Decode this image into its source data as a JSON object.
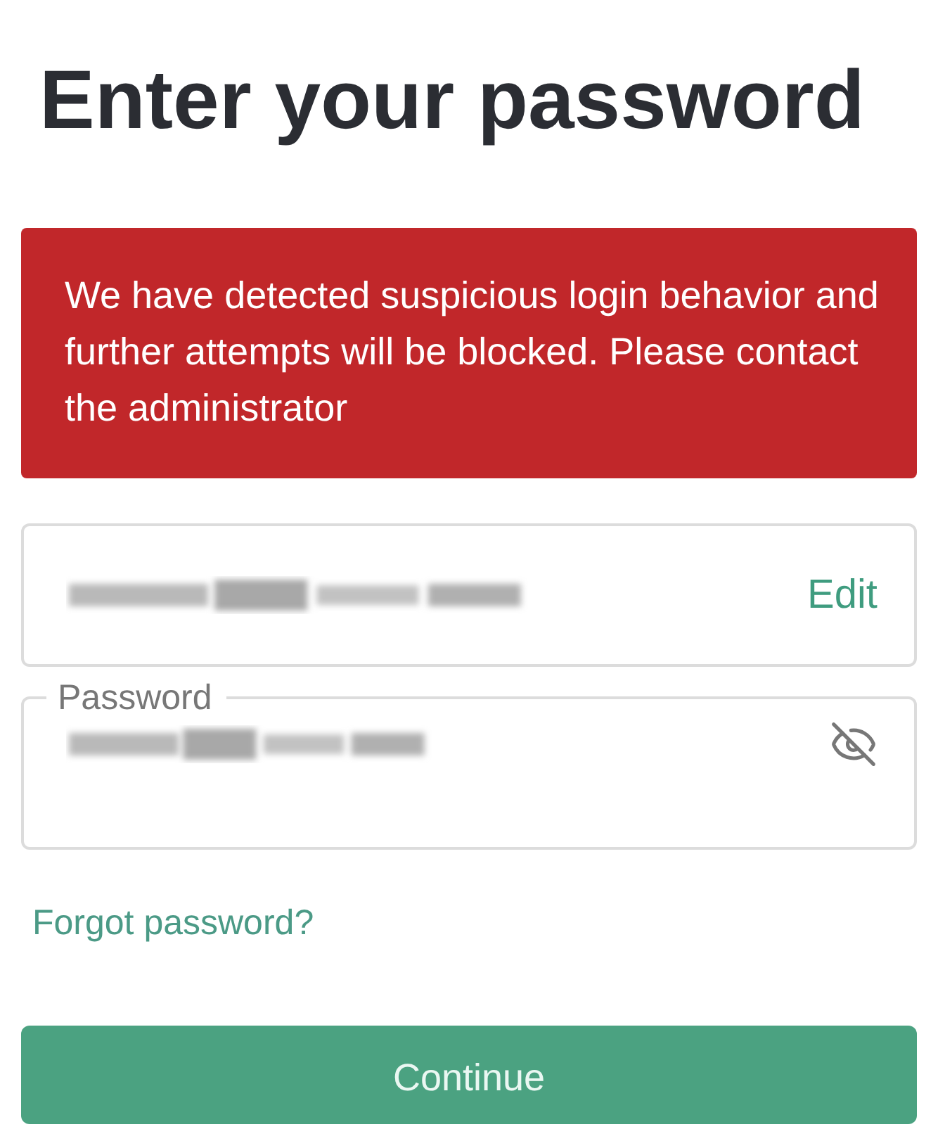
{
  "heading": "Enter your password",
  "alert": {
    "message": "We have detected suspicious login behavior and further attempts will be blocked. Please contact the administrator"
  },
  "email_field": {
    "action": "Edit"
  },
  "password_field": {
    "label": "Password",
    "masked": true
  },
  "forgot_link": "Forgot password?",
  "continue_button": "Continue"
}
